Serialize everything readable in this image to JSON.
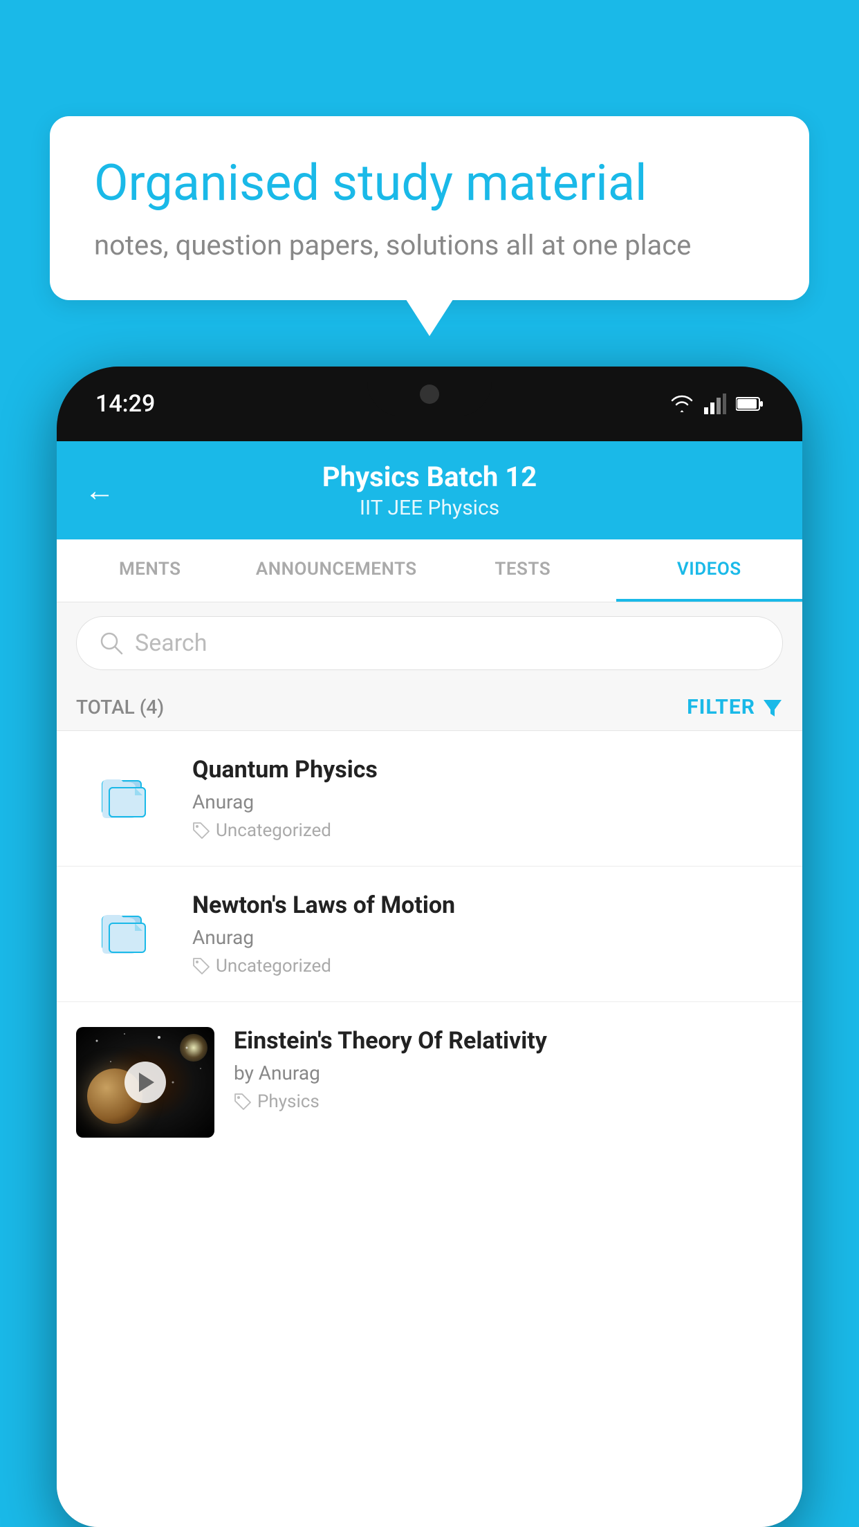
{
  "background": {
    "color": "#1ab9e8"
  },
  "speech_bubble": {
    "title": "Organised study material",
    "subtitle": "notes, question papers, solutions all at one place"
  },
  "phone": {
    "status_bar": {
      "time": "14:29",
      "icons": [
        "wifi",
        "signal",
        "battery"
      ]
    },
    "header": {
      "back_label": "←",
      "title": "Physics Batch 12",
      "subtitle": "IIT JEE   Physics"
    },
    "tabs": [
      {
        "label": "MENTS",
        "active": false
      },
      {
        "label": "ANNOUNCEMENTS",
        "active": false
      },
      {
        "label": "TESTS",
        "active": false
      },
      {
        "label": "VIDEOS",
        "active": true
      }
    ],
    "search": {
      "placeholder": "Search"
    },
    "filter_row": {
      "total_label": "TOTAL (4)",
      "filter_label": "FILTER"
    },
    "videos": [
      {
        "id": "v1",
        "title": "Quantum Physics",
        "author": "Anurag",
        "tag": "Uncategorized",
        "has_thumb": false
      },
      {
        "id": "v2",
        "title": "Newton's Laws of Motion",
        "author": "Anurag",
        "tag": "Uncategorized",
        "has_thumb": false
      },
      {
        "id": "v3",
        "title": "Einstein's Theory Of Relativity",
        "author": "by Anurag",
        "tag": "Physics",
        "has_thumb": true
      }
    ]
  }
}
